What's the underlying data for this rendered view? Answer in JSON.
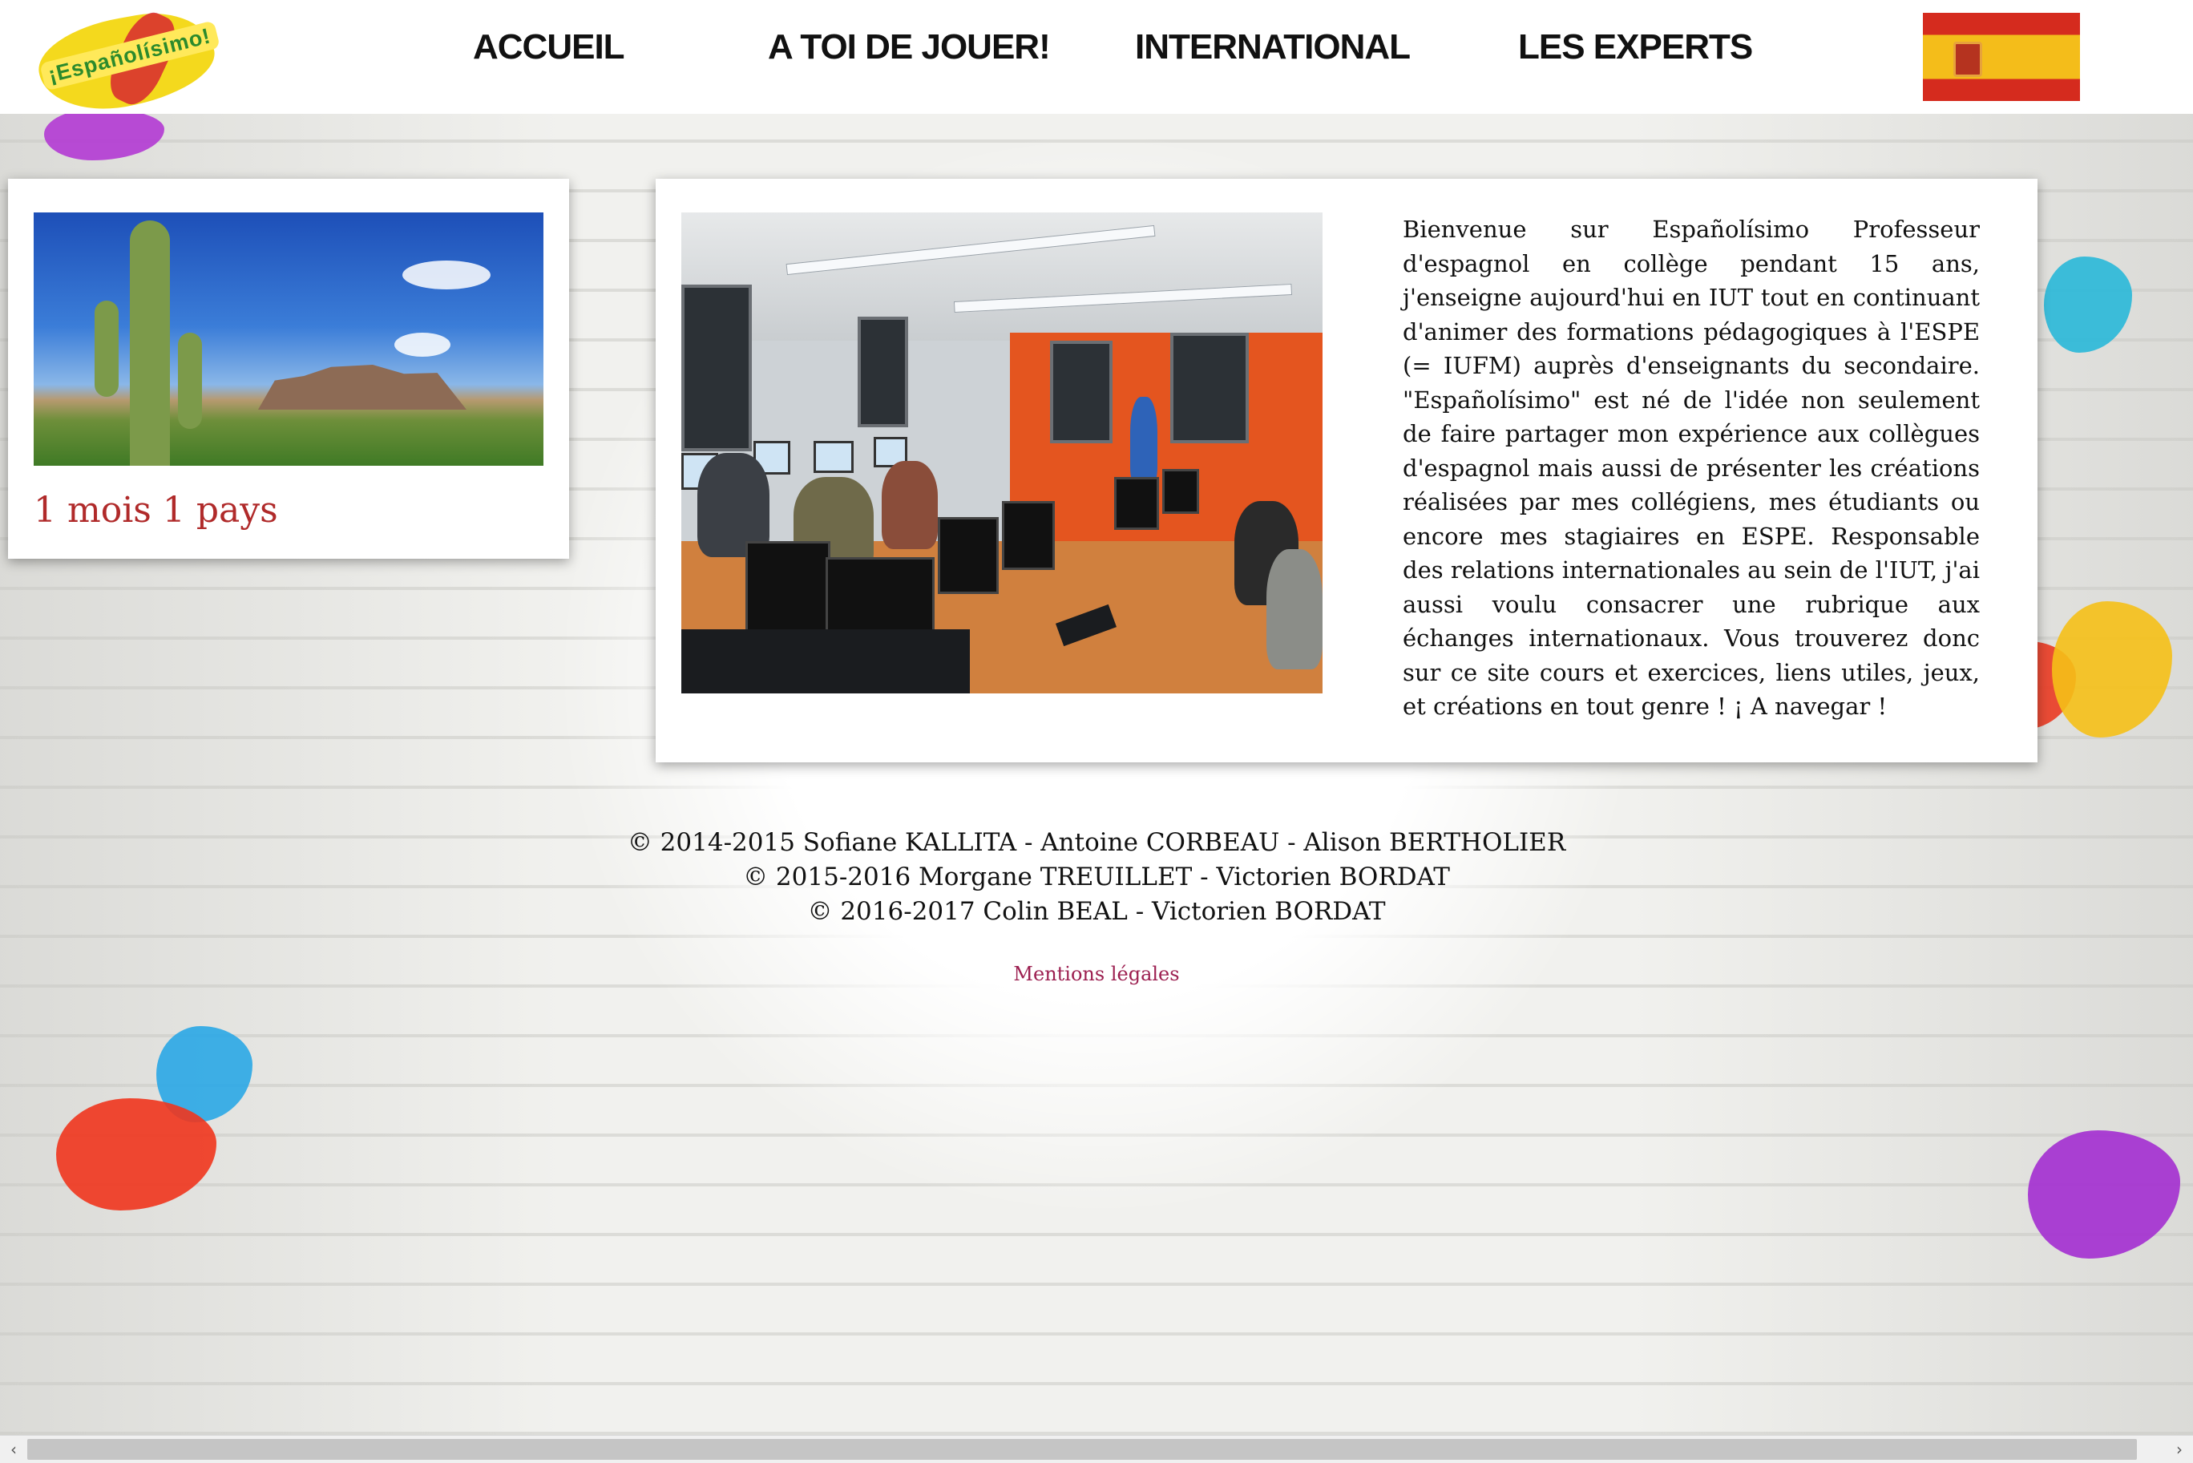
{
  "header": {
    "logo_text": "¡Españolísimo!",
    "nav": [
      {
        "label": "ACCUEIL"
      },
      {
        "label": "A TOI DE JOUER!"
      },
      {
        "label": "INTERNATIONAL"
      },
      {
        "label": "LES EXPERTS"
      }
    ],
    "flag": "spain-flag"
  },
  "featured": {
    "label": "1 mois 1 pays",
    "image": "cactus-desert-photo"
  },
  "intro": {
    "image": "computer-classroom-photo",
    "text": "Bienvenue sur Españolísimo Professeur d'espagnol en collège pendant 15 ans, j'enseigne aujourd'hui en IUT tout en continuant d'animer des formations pédagogiques à l'ESPE (= IUFM) auprès d'enseignants du secondaire. \"Españolísimo\" est né de l'idée non seulement de faire partager mon expérience aux collègues d'espagnol mais aussi de présenter les créations réalisées par mes collégiens, mes étudiants ou encore mes stagiaires en ESPE. Responsable des relations internationales au sein de l'IUT, j'ai aussi voulu consacrer une rubrique aux échanges internationaux. Vous trouverez donc sur ce site cours et exercices, liens utiles, jeux, et créations en tout genre ! ¡ A navegar !"
  },
  "footer": {
    "copyright_lines": [
      "© 2014-2015 Sofiane KALLITA - Antoine CORBEAU - Alison BERTHOLIER",
      "© 2015-2016 Morgane TREUILLET - Victorien BORDAT",
      "© 2016-2017 Colin BEAL - Victorien BORDAT"
    ],
    "legal_link": "Mentions légales"
  },
  "scrollbar": {
    "left_arrow": "‹",
    "right_arrow": "›"
  },
  "colors": {
    "accent_red": "#b02a2a",
    "link": "#9c1f50"
  }
}
